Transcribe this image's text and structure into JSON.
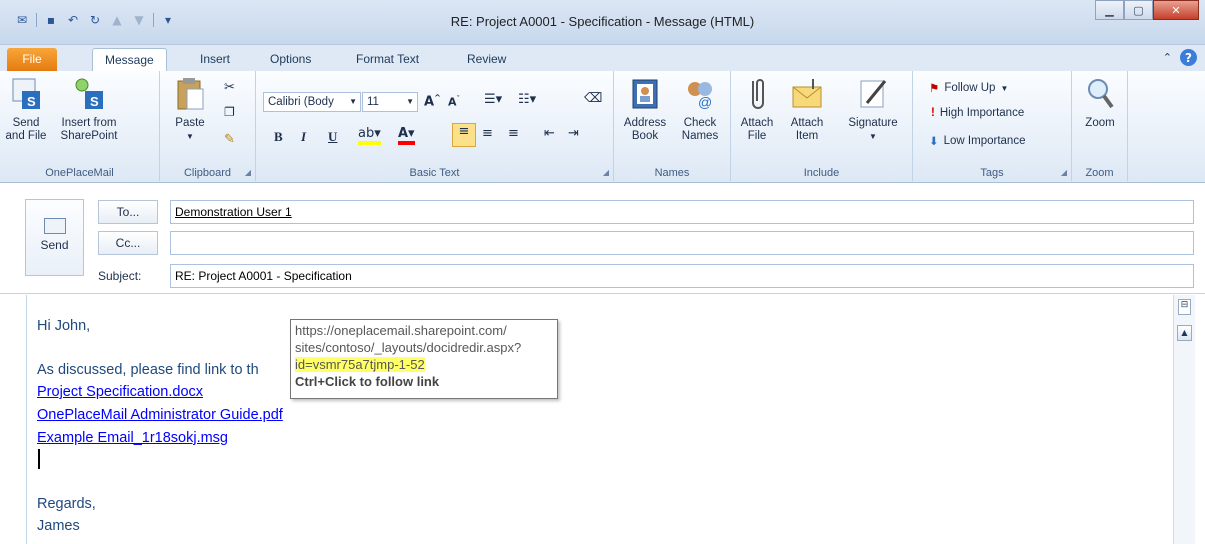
{
  "window": {
    "title": "RE: Project A0001 - Specification  -  Message (HTML)"
  },
  "tabs": [
    "File",
    "Message",
    "Insert",
    "Options",
    "Format Text",
    "Review"
  ],
  "ribbon": {
    "oneplacemail": {
      "label": "OnePlaceMail",
      "send_and_file": "Send\nand File",
      "insert_from": "Insert from\nSharePoint"
    },
    "clipboard": {
      "label": "Clipboard",
      "paste": "Paste"
    },
    "basic_text": {
      "label": "Basic Text",
      "font": "Calibri (Body",
      "size": "11"
    },
    "names": {
      "label": "Names",
      "address_book": "Address\nBook",
      "check_names": "Check\nNames"
    },
    "include": {
      "label": "Include",
      "attach_file": "Attach\nFile",
      "attach_item": "Attach\nItem",
      "signature": "Signature"
    },
    "tags": {
      "label": "Tags",
      "follow_up": "Follow Up",
      "high": "High Importance",
      "low": "Low Importance"
    },
    "zoom": {
      "label": "Zoom",
      "zoom_btn": "Zoom"
    }
  },
  "compose": {
    "send": "Send",
    "to_btn": "To...",
    "cc_btn": "Cc...",
    "subject_label": "Subject:",
    "to_value": "Demonstration User 1",
    "cc_value": "",
    "subject_value": "RE: Project A0001 - Specification"
  },
  "body": {
    "greeting": "Hi John,",
    "intro": "As discussed, please find link to th",
    "links": [
      "Project Specification.docx",
      "OnePlaceMail Administrator Guide.pdf",
      "Example Email_1r18sokj.msg"
    ],
    "regards": "Regards,",
    "name": "James"
  },
  "tooltip": {
    "line1": "https://oneplacemail.sharepoint.com/",
    "line2": "sites/contoso/_layouts/docidredir.aspx?",
    "line3": "id=vsmr75a7tjmp-1-52",
    "line4": "Ctrl+Click to follow link"
  }
}
